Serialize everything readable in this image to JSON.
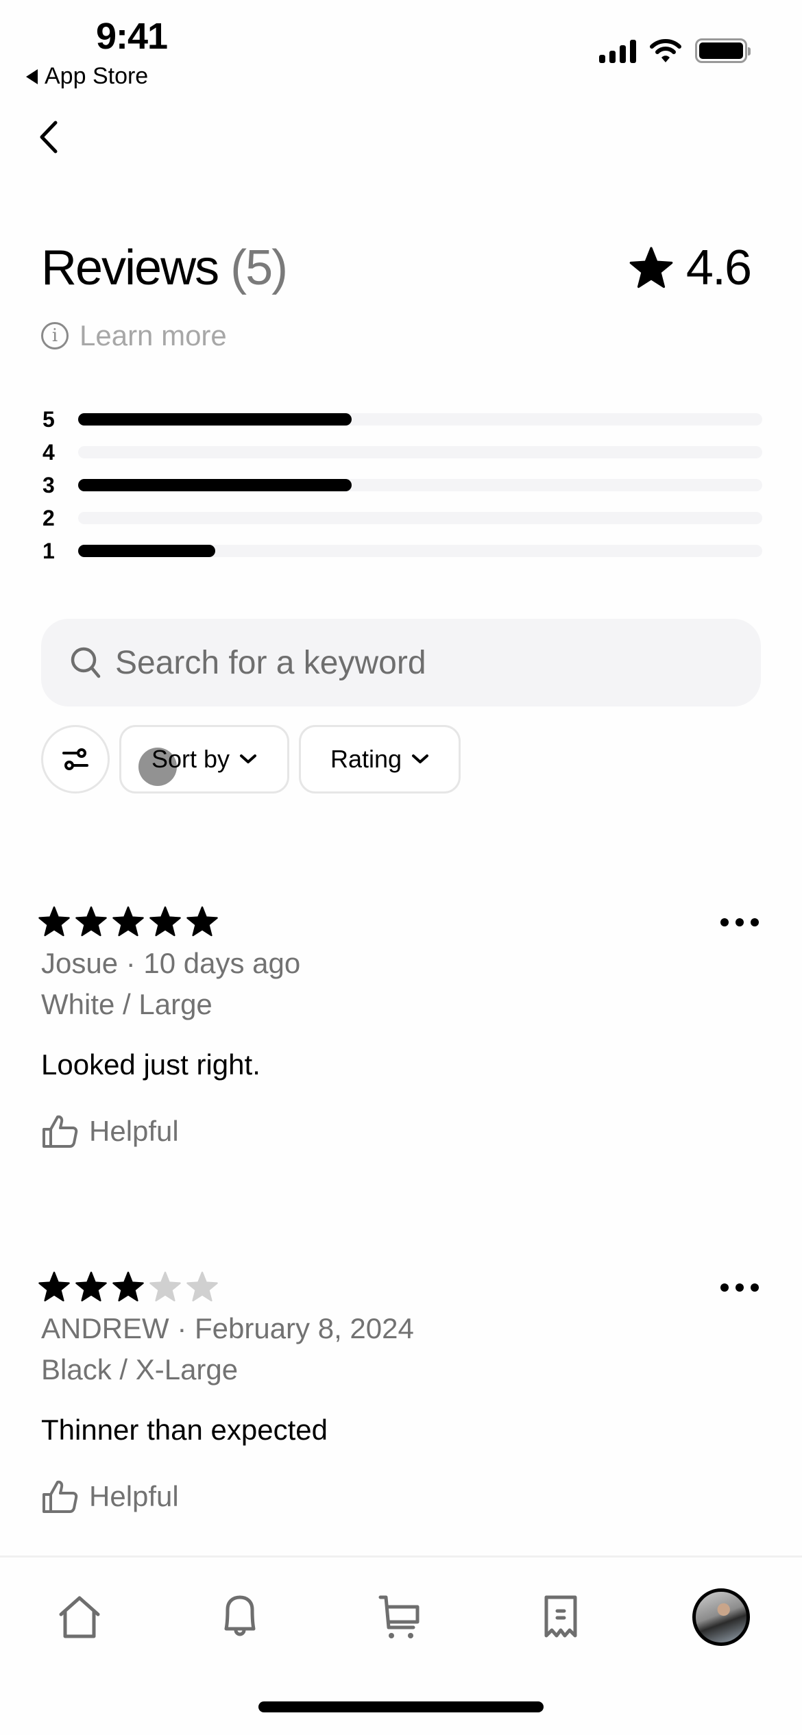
{
  "status_bar": {
    "time": "9:41",
    "back_app": "App Store"
  },
  "header": {
    "title": "Reviews",
    "count": "(5)",
    "average_rating": "4.6",
    "learn_more": "Learn more"
  },
  "rating_distribution": [
    {
      "label": "5",
      "fraction": 0.4
    },
    {
      "label": "4",
      "fraction": 0.0
    },
    {
      "label": "3",
      "fraction": 0.4
    },
    {
      "label": "2",
      "fraction": 0.0
    },
    {
      "label": "1",
      "fraction": 0.2
    }
  ],
  "search": {
    "placeholder": "Search for a keyword",
    "value": ""
  },
  "filters": {
    "sort_label": "Sort by",
    "rating_label": "Rating"
  },
  "reviews": [
    {
      "stars": 5,
      "author": "Josue",
      "date": "10 days ago",
      "meta": "Josue · 10 days ago",
      "variant": "White / Large",
      "text": "Looked just right.",
      "helpful_label": "Helpful"
    },
    {
      "stars": 3,
      "author": "ANDREW",
      "date": "February 8, 2024",
      "meta": "ANDREW · February 8, 2024",
      "variant": "Black / X-Large",
      "text": "Thinner than expected",
      "helpful_label": "Helpful"
    }
  ],
  "tab_bar": [
    {
      "icon": "home-icon"
    },
    {
      "icon": "bell-icon"
    },
    {
      "icon": "cart-icon"
    },
    {
      "icon": "receipt-icon"
    },
    {
      "icon": "avatar"
    }
  ],
  "colors": {
    "text": "#000000",
    "secondary": "#727272",
    "muted": "#a7a7a7",
    "surface": "#f4f4f6",
    "star_empty": "#d0d0d0"
  }
}
